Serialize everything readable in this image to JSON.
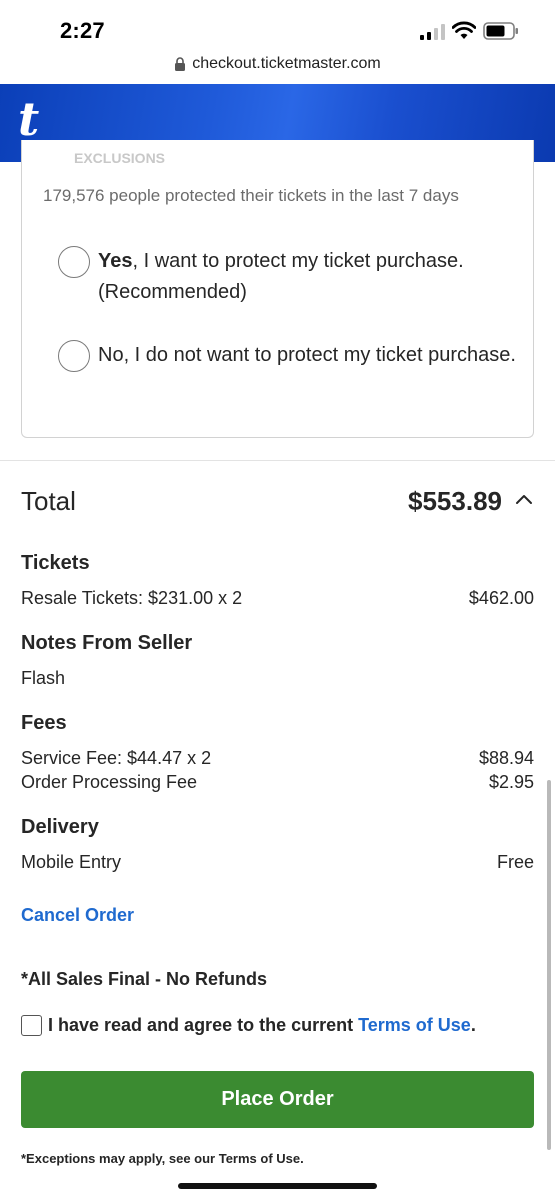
{
  "status_bar": {
    "time": "2:27"
  },
  "browser": {
    "url": "checkout.ticketmaster.com"
  },
  "brand": {
    "logo_letter": "t",
    "color": "#1f5ad9"
  },
  "protection": {
    "faded_heading": "EXCLUSIONS",
    "stat": "179,576 people protected their tickets in the last 7 days",
    "yes_bold": "Yes",
    "yes_rest": ", I want to protect my ticket purchase. (Recommended)",
    "no_label": "No, I do not want to protect my ticket purchase."
  },
  "order": {
    "total_label": "Total",
    "total_amount": "$553.89",
    "tickets": {
      "title": "Tickets",
      "line_label": "Resale Tickets: $231.00 x 2",
      "line_value": "$462.00"
    },
    "notes": {
      "title": "Notes From Seller",
      "text": "Flash"
    },
    "fees": {
      "title": "Fees",
      "service_label": "Service Fee: $44.47 x 2",
      "service_value": "$88.94",
      "processing_label": "Order Processing Fee",
      "processing_value": "$2.95"
    },
    "delivery": {
      "title": "Delivery",
      "label": "Mobile Entry",
      "value": "Free"
    }
  },
  "actions": {
    "cancel": "Cancel Order",
    "final_note": "*All Sales Final - No Refunds",
    "agree_text": "I have read and agree to the current ",
    "terms_link": "Terms of Use",
    "agree_period": ".",
    "place_order": "Place Order",
    "exceptions": "*Exceptions may apply, see our Terms of Use.",
    "button_color": "#3b8b31",
    "link_color": "#1f6acf"
  }
}
